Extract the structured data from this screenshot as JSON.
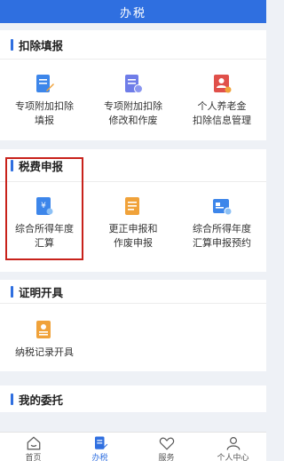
{
  "header": {
    "title": "办税"
  },
  "sections": {
    "deduction": {
      "title": "扣除填报",
      "items": [
        {
          "line1": "专项附加扣除",
          "line2": "填报"
        },
        {
          "line1": "专项附加扣除",
          "line2": "修改和作废"
        },
        {
          "line1": "个人养老金",
          "line2": "扣除信息管理"
        }
      ]
    },
    "tax_filing": {
      "title": "税费申报",
      "items": [
        {
          "line1": "综合所得年度",
          "line2": "汇算"
        },
        {
          "line1": "更正申报和",
          "line2": "作废申报"
        },
        {
          "line1": "综合所得年度",
          "line2": "汇算申报预约"
        }
      ]
    },
    "certificate": {
      "title": "证明开具",
      "items": [
        {
          "line1": "纳税记录开具",
          "line2": ""
        }
      ]
    },
    "entrust": {
      "title": "我的委托"
    }
  },
  "tabs": [
    {
      "label": "首页",
      "icon": "home-icon"
    },
    {
      "label": "办税",
      "icon": "tax-icon",
      "active": true
    },
    {
      "label": "服务",
      "icon": "service-icon"
    },
    {
      "label": "个人中心",
      "icon": "user-icon"
    }
  ],
  "colors": {
    "accent": "#2f6fe0",
    "highlight": "#c8221b",
    "orange": "#f0a23a",
    "red": "#e0504a"
  }
}
